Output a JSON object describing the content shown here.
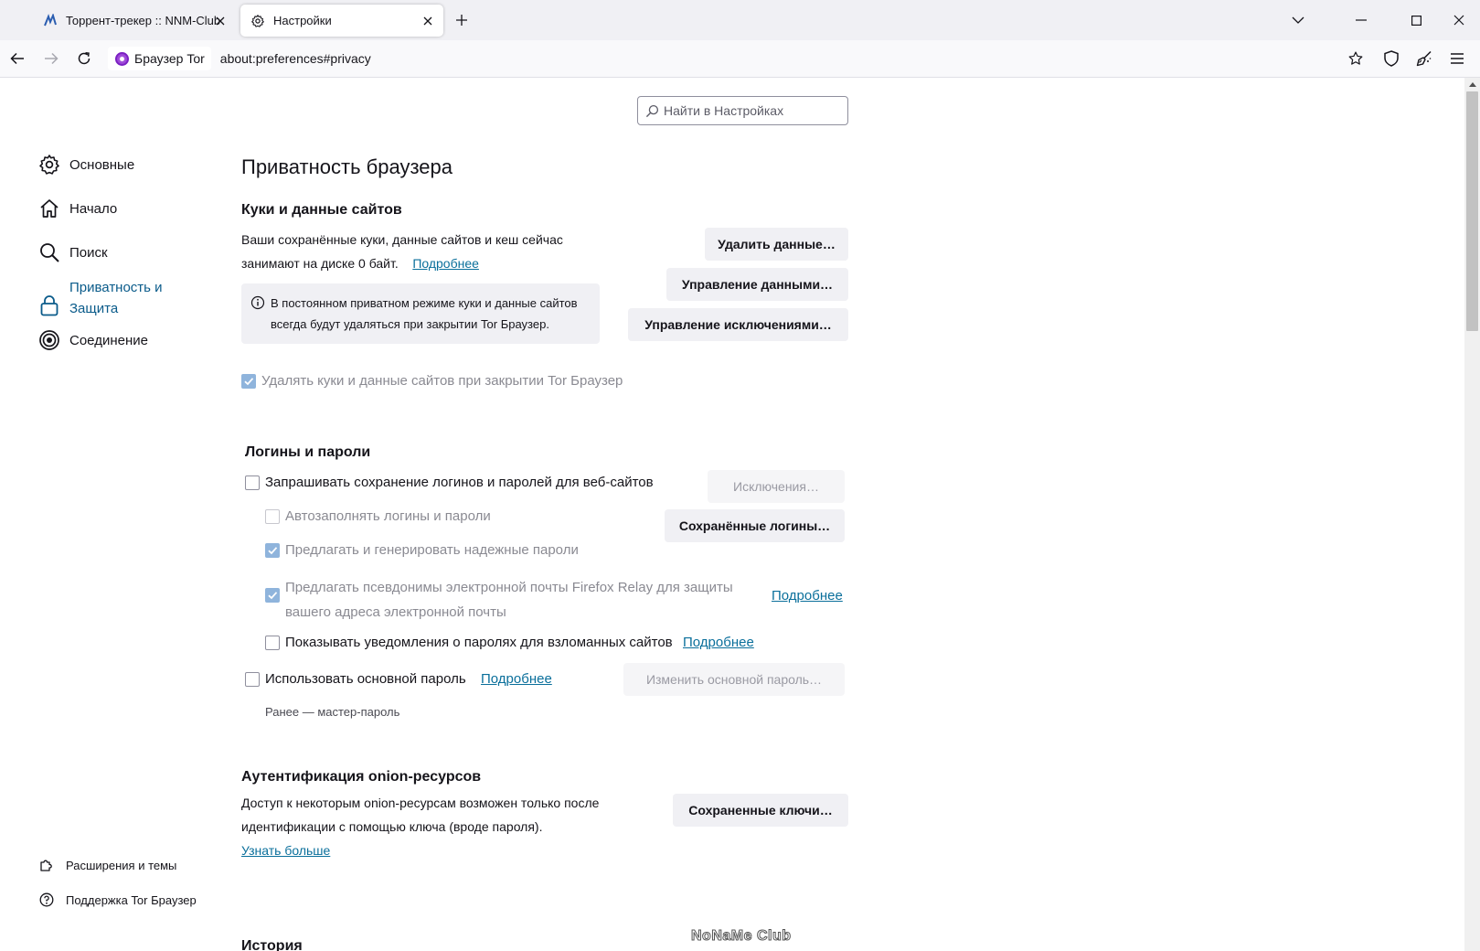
{
  "tabs": [
    {
      "title": "Торрент-трекер :: NNM-Club",
      "icon": "nnm-club-favicon"
    },
    {
      "title": "Настройки",
      "icon": "gear-icon",
      "active": true
    }
  ],
  "navbar": {
    "identity_label": "Браузер Tor",
    "url": "about:preferences#privacy"
  },
  "search": {
    "placeholder": "Найти в Настройках"
  },
  "sidebar": {
    "items": [
      {
        "label": "Основные",
        "icon": "gear-icon"
      },
      {
        "label": "Начало",
        "icon": "home-icon"
      },
      {
        "label": "Поиск",
        "icon": "search-icon"
      },
      {
        "label_line1": "Приватность и",
        "label_line2": "Защита",
        "icon": "lock-icon",
        "selected": true
      },
      {
        "label": "Соединение",
        "icon": "onion-icon"
      }
    ],
    "footer": [
      {
        "label": "Расширения и темы",
        "icon": "puzzle-icon"
      },
      {
        "label": "Поддержка Tor Браузер",
        "icon": "help-icon"
      }
    ]
  },
  "page": {
    "title": "Приватность браузера"
  },
  "cookies": {
    "heading": "Куки и данные сайтов",
    "text_line1": "Ваши сохранённые куки, данные сайтов и кеш сейчас",
    "text_line2": "занимают на диске 0 байт.",
    "learn_more": "Подробнее",
    "info_line1": "В постоянном приватном режиме куки и данные сайтов",
    "info_line2": "всегда будут удаляться при закрытии Tor Браузер.",
    "btn_clear": "Удалить данные…",
    "btn_manage": "Управление данными…",
    "btn_exceptions": "Управление исключениями…",
    "delete_on_close_label": "Удалять куки и данные сайтов при закрытии Tor Браузер",
    "delete_on_close_checked": true
  },
  "logins": {
    "heading": "Логины и пароли",
    "ask_save_label": "Запрашивать сохранение логинов и паролей для веб-сайтов",
    "btn_exceptions": "Исключения…",
    "autofill_label": "Автозаполнять логины и пароли",
    "btn_saved": "Сохранённые логины…",
    "suggest_label": "Предлагать и генерировать надежные пароли",
    "relay_line1": "Предлагать псевдонимы электронной почты Firefox Relay для защиты",
    "relay_line2": "вашего адреса электронной почты",
    "relay_learn_more": "Подробнее",
    "breach_label": "Показывать уведомления о паролях для взломанных сайтов",
    "breach_learn_more": "Подробнее",
    "primary_label": "Использовать основной пароль",
    "primary_learn_more": "Подробнее",
    "btn_change_primary": "Изменить основной пароль…",
    "formerly": "Ранее — мастер-пароль"
  },
  "onion": {
    "heading": "Аутентификация onion-ресурсов",
    "text_line1": "Доступ к некоторым onion-ресурсам возможен только после",
    "text_line2": "идентификации с помощью ключа (вроде пароля).",
    "learn_more": "Узнать больше",
    "btn_keys": "Сохраненные ключи…"
  },
  "history": {
    "heading": "История"
  },
  "watermark": "NoNaMe Club",
  "colors": {
    "accent": "#0061e0",
    "link": "#0a6f9b",
    "button_bg": "#f0f0f4",
    "checked_dim": "#8fb4dc"
  }
}
